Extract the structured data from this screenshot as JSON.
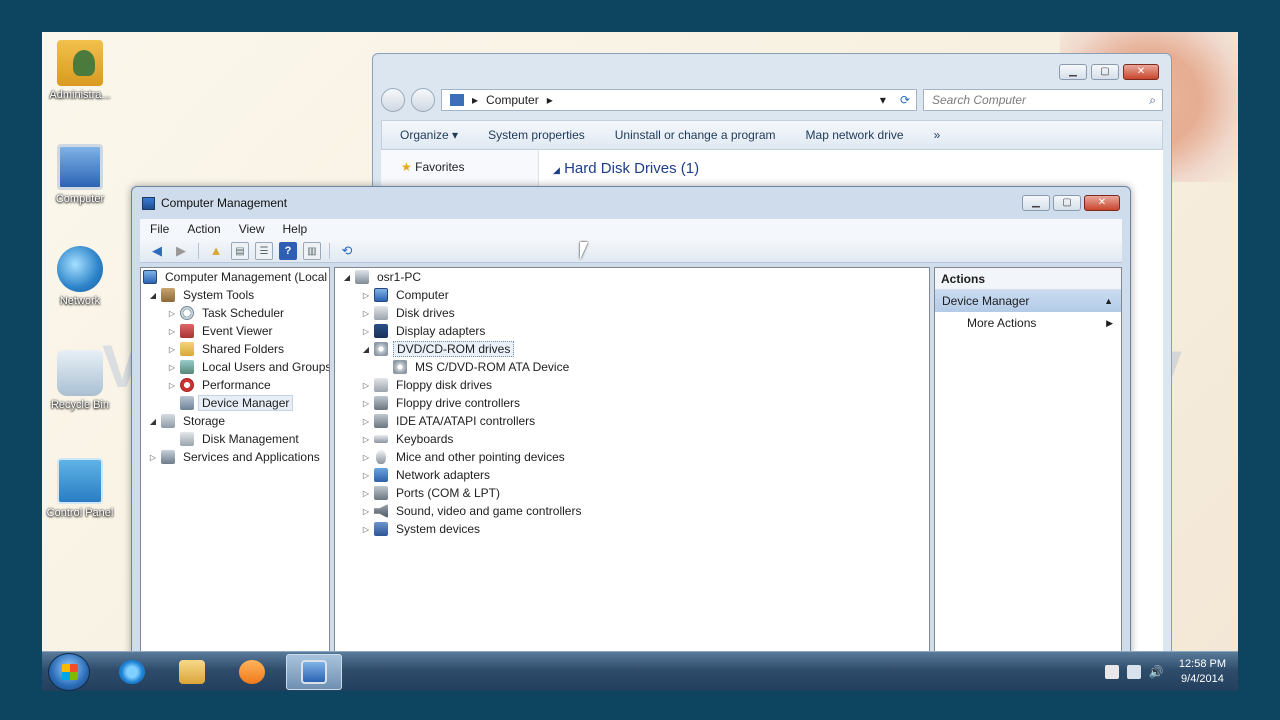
{
  "desktop": {
    "icons": [
      {
        "label": "Administra..."
      },
      {
        "label": "Computer"
      },
      {
        "label": "Network"
      },
      {
        "label": "Recycle Bin"
      },
      {
        "label": "Control Panel"
      }
    ]
  },
  "explorer": {
    "breadcrumb": "Computer",
    "search_placeholder": "Search Computer",
    "commands": [
      "Organize",
      "System properties",
      "Uninstall or change a program",
      "Map network drive",
      "»"
    ],
    "nav_favorites": "Favorites",
    "section_header": "Hard Disk Drives (1)"
  },
  "cm": {
    "title": "Computer Management",
    "menu": [
      "File",
      "Action",
      "View",
      "Help"
    ],
    "left_tree": {
      "root": "Computer Management (Local",
      "system_tools": "System Tools",
      "items": [
        "Task Scheduler",
        "Event Viewer",
        "Shared Folders",
        "Local Users and Groups",
        "Performance",
        "Device Manager"
      ],
      "storage": "Storage",
      "disk_management": "Disk Management",
      "services": "Services and Applications"
    },
    "device_tree": {
      "root": "osr1-PC",
      "categories": [
        "Computer",
        "Disk drives",
        "Display adapters",
        "DVD/CD-ROM drives",
        "MS C/DVD-ROM ATA Device",
        "Floppy disk drives",
        "Floppy drive controllers",
        "IDE ATA/ATAPI controllers",
        "Keyboards",
        "Mice and other pointing devices",
        "Network adapters",
        "Ports (COM & LPT)",
        "Sound, video and game controllers",
        "System devices"
      ]
    },
    "actions": {
      "header": "Actions",
      "section": "Device Manager",
      "more": "More Actions"
    }
  },
  "taskbar": {
    "time": "12:58 PM",
    "date": "9/4/2014"
  }
}
